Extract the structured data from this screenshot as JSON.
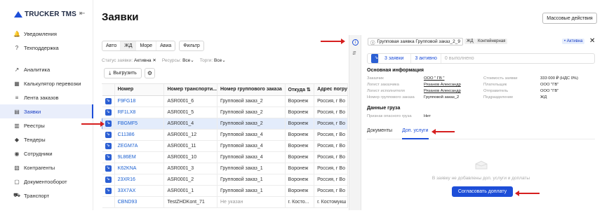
{
  "logo": {
    "text": "TRUCKER TMS"
  },
  "sidebar": {
    "items": [
      {
        "icon": "bell-icon",
        "glyph": "🔔",
        "label": "Уведомления"
      },
      {
        "icon": "help-icon",
        "glyph": "?",
        "label": "Техподдержка"
      },
      {
        "icon": "analytics-icon",
        "glyph": "↗",
        "label": "Аналитика"
      },
      {
        "icon": "calculator-icon",
        "glyph": "▦",
        "label": "Калькулятор перевозки"
      },
      {
        "icon": "feed-icon",
        "glyph": "≡",
        "label": "Лента заказов"
      },
      {
        "icon": "requests-icon",
        "glyph": "▤",
        "label": "Заявки"
      },
      {
        "icon": "registry-icon",
        "glyph": "▥",
        "label": "Реестры"
      },
      {
        "icon": "tender-icon",
        "glyph": "◆",
        "label": "Тендеры"
      },
      {
        "icon": "staff-icon",
        "glyph": "◉",
        "label": "Сотрудники"
      },
      {
        "icon": "contractors-icon",
        "glyph": "▧",
        "label": "Контрагенты"
      },
      {
        "icon": "docs-icon",
        "glyph": "▢",
        "label": "Документооборот"
      },
      {
        "icon": "truck-icon",
        "glyph": "⛟",
        "label": "Транспорт"
      }
    ]
  },
  "header": {
    "title": "Заявки",
    "mass_actions": "Массовые действия"
  },
  "mode_tabs": [
    "Авто",
    "ЖД",
    "Море",
    "Авиа"
  ],
  "filter_label": "Фильтр",
  "status_line": {
    "status_label": "Статус заявки:",
    "status_value": "Активна",
    "resources_label": "Ресурсы:",
    "resources_value": "Все",
    "trades_label": "Торги:",
    "trades_value": "Все"
  },
  "export_label": "Выгрузить",
  "table": {
    "headers": [
      "",
      "Номер",
      "Номер транспорти...",
      "Номер группового заказа",
      "Откуда ⇅",
      "Адрес погру"
    ],
    "rows": [
      [
        "F9FG18",
        "ASR0001_6",
        "Групповой заказ_2",
        "Воронеж",
        "Россия, г Во"
      ],
      [
        "RF1LX8",
        "ASR0001_5",
        "Групповой заказ_2",
        "Воронеж",
        "Россия, г Во"
      ],
      [
        "FBGMF5",
        "ASR0001_4",
        "Групповой заказ_2",
        "Воронеж",
        "Россия, г Во"
      ],
      [
        "C11386",
        "ASR0001_12",
        "Групповой заказ_4",
        "Воронеж",
        "Россия, г Во"
      ],
      [
        "ZEGM7A",
        "ASR0001_11",
        "Групповой заказ_4",
        "Воронеж",
        "Россия, г Во"
      ],
      [
        "9L86EM",
        "ASR0001_10",
        "Групповой заказ_4",
        "Воронеж",
        "Россия, г Во"
      ],
      [
        "K62KNA",
        "ASR0001_3",
        "Групповой заказ_1",
        "Воронеж",
        "Россия, г Во"
      ],
      [
        "23XR16",
        "ASR0001_2",
        "Групповой заказ_1",
        "Воронеж",
        "Россия, г Во"
      ],
      [
        "33X7AX",
        "ASR0001_1",
        "Групповой заказ_1",
        "Воронеж",
        "Россия, г Во"
      ],
      [
        "CBND93",
        "TestZHDKont_71",
        "Не указан",
        "г. Косто...",
        "г. Костомукш"
      ]
    ],
    "selected_row": 2
  },
  "panel": {
    "chip": "Групповая заявка Групповой заказ_2_9",
    "tag_rail": "ЖД",
    "tag_container": "Контейнерная",
    "tag_active": "Активна",
    "counts": {
      "requests": "3 заявки",
      "active": "3 активно",
      "done": "0 выполнено"
    },
    "main_info_title": "Основная информация",
    "left_fields": [
      {
        "k": "Заказчик",
        "v": "ООО \" ГВ \""
      },
      {
        "k": "Логист заказчика",
        "v": "Рязанов Александр"
      },
      {
        "k": "Логист исполнителя",
        "v": "Рязанов Александр"
      },
      {
        "k": "Номер группового заказа",
        "v": "Групповой заказ_2"
      }
    ],
    "right_fields": [
      {
        "k": "Стоимость заявки",
        "v": "333 000 ₽ (НДС 0%)"
      },
      {
        "k": "Плательщик",
        "v": "ООО \"ГВ\""
      },
      {
        "k": "Отправитель",
        "v": "ООО \"ГВ\""
      },
      {
        "k": "Подразделение",
        "v": "ЖД"
      }
    ],
    "cargo_title": "Данные груза",
    "cargo_field": {
      "k": "Признак опасного груза",
      "v": "Нет"
    },
    "sub_tabs": [
      "Документы",
      "Доп. услуги"
    ],
    "empty_text": "В заявку не добавлены доп. услуги и доплаты",
    "agree_button": "Согласовать доплату"
  },
  "colors": {
    "accent": "#1d4ed8",
    "arrow": "#d61f1f",
    "selected_row": "#e3ecfb"
  }
}
